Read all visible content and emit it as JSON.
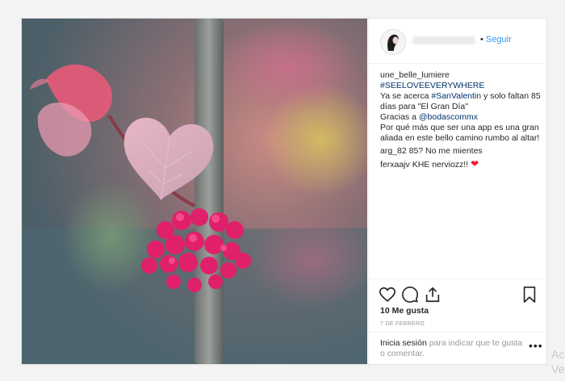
{
  "header": {
    "follow_separator": "•",
    "follow_label": "Seguir"
  },
  "caption": {
    "user": "une_belle_lumiere",
    "hashtag_main": "#SEELOVEEVERYWHERE",
    "line1_a": "Ya se acerca ",
    "hashtag_valentine": "#SanValentin",
    "line1_b": " y solo faltan 85 días para \"El Gran Día\"",
    "thanks_a": "Gracias a ",
    "mention": "@bodascommx",
    "body": "Por qué más que ser una app es una gran aliada en este bello camino rumbo al altar!"
  },
  "comments": [
    {
      "user": "arg_82",
      "text": "85? No me mientes"
    },
    {
      "user": "ferxaajv",
      "text": "KHE nerviozz!!",
      "emoji": "❤"
    }
  ],
  "actions": {
    "like_icon": "heart-outline-icon",
    "comment_icon": "comment-icon",
    "share_icon": "share-icon",
    "save_icon": "bookmark-icon"
  },
  "likes_label": "10 Me gusta",
  "date_label": "7 DE FEBRERO",
  "login": {
    "link": "Inicia sesión",
    "rest": " para indicar que te gusta o comentar.",
    "more_label": "•••"
  },
  "watermark": {
    "line1": "Ac",
    "line2": "Ve"
  },
  "colors": {
    "link_blue": "#3897f0",
    "hashtag_blue": "#003569",
    "heart_red": "#ed1c3a"
  }
}
